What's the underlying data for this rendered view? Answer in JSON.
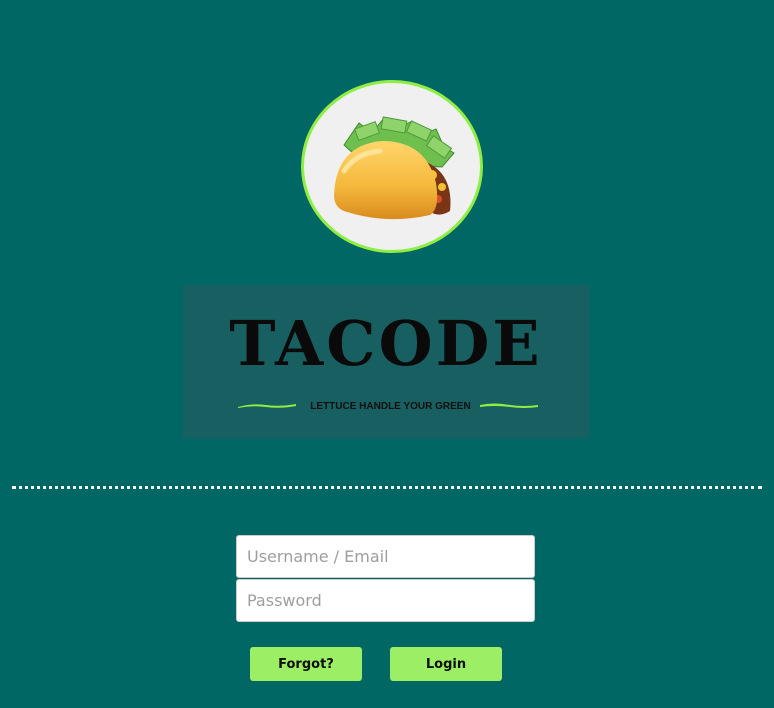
{
  "brand": {
    "logo_icon": "taco-icon",
    "title": "TACODE",
    "tagline": "LETTUCE HANDLE YOUR GREEN"
  },
  "login_form": {
    "username_placeholder": "Username / Email",
    "username_value": "",
    "password_placeholder": "Password",
    "password_value": "",
    "forgot_label": "Forgot?",
    "login_label": "Login"
  },
  "colors": {
    "background": "#006764",
    "accent": "#9cee65",
    "logo_ring": "#8fee42",
    "brand_box": "#175f60"
  }
}
